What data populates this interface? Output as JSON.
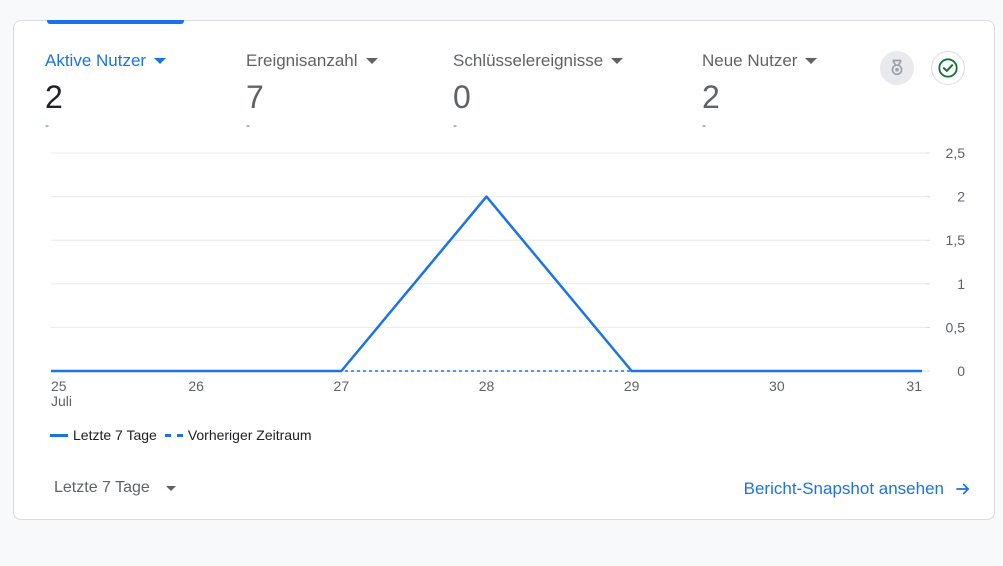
{
  "metrics": [
    {
      "label": "Aktive Nutzer",
      "value": "2",
      "change": "-",
      "active": true
    },
    {
      "label": "Ereignisanzahl",
      "value": "7",
      "change": "-",
      "active": false
    },
    {
      "label": "Schlüsselereignisse",
      "value": "0",
      "change": "-",
      "active": false
    },
    {
      "label": "Neue Nutzer",
      "value": "2",
      "change": "-",
      "active": false
    }
  ],
  "icons": {
    "insights": "award-icon",
    "status": "check-circle-icon"
  },
  "chart_data": {
    "type": "line",
    "x": [
      "25",
      "26",
      "27",
      "28",
      "29",
      "30",
      "31"
    ],
    "x_sublabel": {
      "index": 0,
      "text": "Juli"
    },
    "series": [
      {
        "name": "Letzte 7 Tage",
        "values": [
          0,
          0,
          0,
          2,
          0,
          0,
          0
        ],
        "style": "solid"
      },
      {
        "name": "Vorheriger Zeitraum",
        "values": [
          0,
          0,
          0,
          0,
          0,
          0,
          0
        ],
        "style": "dashed"
      }
    ],
    "yticks": [
      "0",
      "0,5",
      "1",
      "1,5",
      "2",
      "2,5"
    ],
    "ylim": [
      0,
      2.5
    ],
    "grid": true,
    "legend": "bottom-left"
  },
  "footer": {
    "range_label": "Letzte 7 Tage",
    "snapshot_label": "Bericht-Snapshot ansehen"
  },
  "colors": {
    "accent": "#1a73e8",
    "positive": "#1e8e3e",
    "grid": "#e8eaed"
  }
}
